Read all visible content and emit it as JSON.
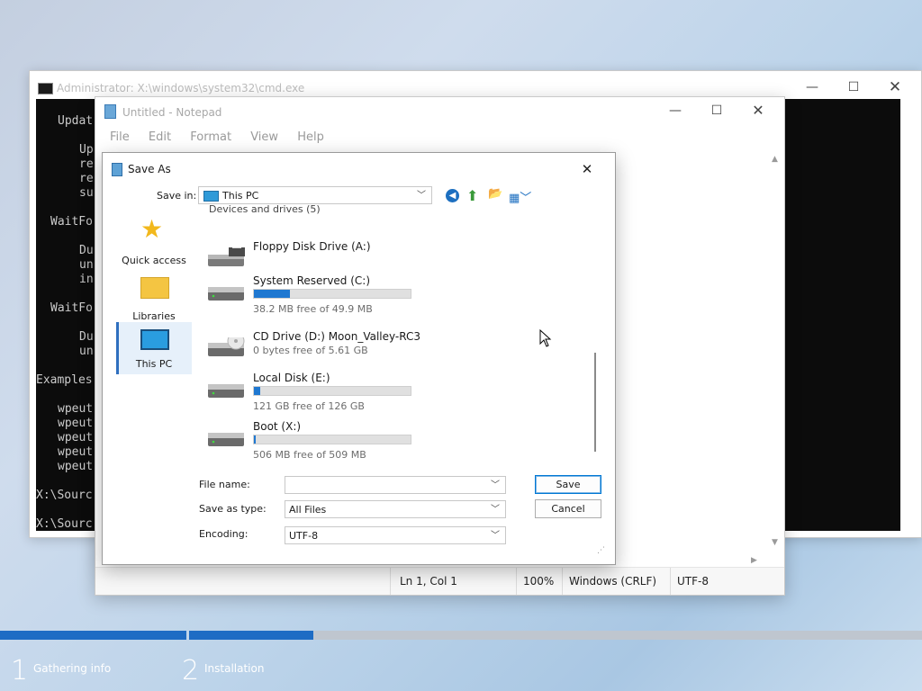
{
  "cmd": {
    "title": "Administrator: X:\\windows\\system32\\cmd.exe",
    "lines": [
      "Updat",
      "Up",
      "re",
      "re",
      "su",
      "WaitFo",
      "Du",
      "un",
      "in",
      "WaitFo",
      "Du",
      "un",
      "Examples",
      "wpeut",
      "wpeut",
      "wpeut",
      "wpeut",
      "wpeut",
      "X:\\Sourc",
      "X:\\Sourc"
    ]
  },
  "notepad": {
    "title": "Untitled - Notepad",
    "menu": [
      "File",
      "Edit",
      "Format",
      "View",
      "Help"
    ],
    "status": {
      "position": "Ln 1, Col 1",
      "zoom": "100%",
      "line_ending": "Windows (CRLF)",
      "encoding": "UTF-8"
    }
  },
  "dialog": {
    "title": "Save As",
    "save_in_label": "Save in:",
    "save_in_value": "This PC",
    "places": [
      "Quick access",
      "Libraries",
      "This PC"
    ],
    "group_header": "Devices and drives (5)",
    "drives": [
      {
        "name": "Floppy Disk Drive (A:)",
        "free": "",
        "used_fraction": null,
        "icon": "floppy-drive-icon"
      },
      {
        "name": "System Reserved (C:)",
        "free": "38.2 MB free of 49.9 MB",
        "used_fraction": 0.23,
        "icon": "hard-disk-icon"
      },
      {
        "name": "CD Drive (D:) Moon_Valley-RC3",
        "free": "0 bytes free of 5.61 GB",
        "used_fraction": null,
        "icon": "cd-drive-icon"
      },
      {
        "name": "Local Disk (E:)",
        "free": "121 GB free of 126 GB",
        "used_fraction": 0.04,
        "icon": "hard-disk-icon"
      },
      {
        "name": "Boot (X:)",
        "free": "506 MB free of 509 MB",
        "used_fraction": 0.01,
        "icon": "hard-disk-icon"
      }
    ],
    "file_name_label": "File name:",
    "file_name_value": "",
    "save_type_label": "Save as type:",
    "save_type_value": "All Files",
    "encoding_label": "Encoding:",
    "encoding_value": "UTF-8",
    "save_button": "Save",
    "cancel_button": "Cancel"
  },
  "setup": {
    "steps": [
      {
        "number": "1",
        "label": "Gathering info"
      },
      {
        "number": "2",
        "label": "Installation"
      }
    ]
  },
  "colors": {
    "accent": "#0078d4",
    "progress": "#1e6cc4",
    "console_bg": "#0c0c0c"
  }
}
